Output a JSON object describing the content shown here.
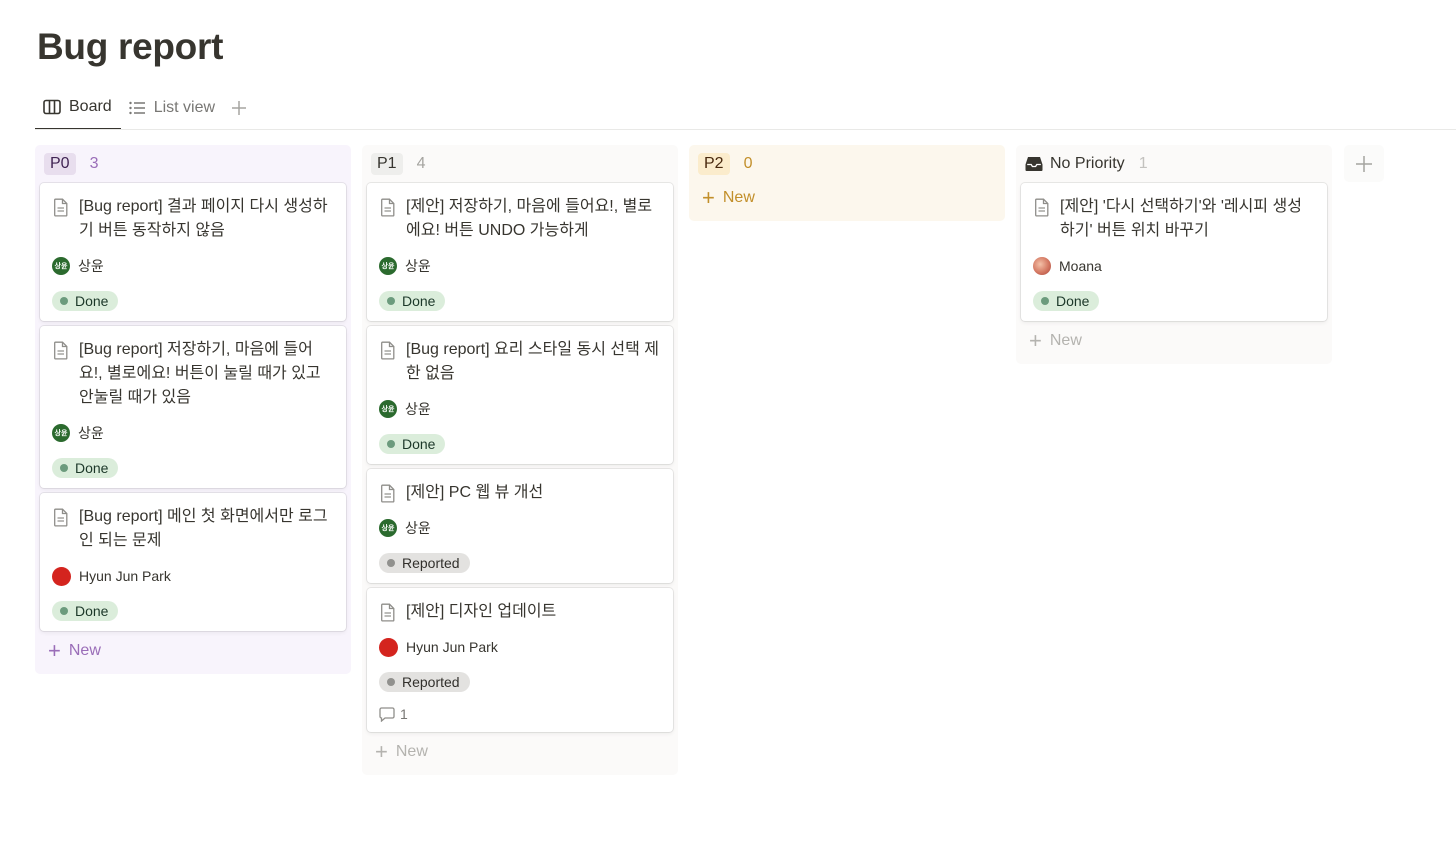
{
  "page": {
    "title": "Bug report"
  },
  "tabs": [
    {
      "label": "Board",
      "icon": "board-icon",
      "active": true
    },
    {
      "label": "List view",
      "icon": "list-icon",
      "active": false
    }
  ],
  "new_label": "New",
  "comment_icon": "comment-icon",
  "columns": [
    {
      "name": "P0",
      "count": "3",
      "colors": {
        "bg": "#f8f4fc",
        "pill_bg": "#e8deee",
        "pill_text": "#412454",
        "count": "#9a6db8",
        "new": "#9a6db8"
      },
      "cards": [
        {
          "title": "[Bug report] 결과 페이지 다시 생성하기 버튼 동작하지 않음",
          "assignee": "상윤",
          "status": "Done"
        },
        {
          "title": "[Bug report] 저장하기, 마음에 들어요!, 별로에요! 버튼이 눌릴 때가 있고 안눌릴 때가 있음",
          "assignee": "상윤",
          "status": "Done"
        },
        {
          "title": "[Bug report] 메인 첫 화면에서만 로그인 되는 문제",
          "assignee": "Hyun Jun Park",
          "status": "Done"
        }
      ]
    },
    {
      "name": "P1",
      "count": "4",
      "colors": {
        "bg": "#fbfaf9",
        "pill_bg": "#eeeeec",
        "pill_text": "#37352f",
        "count": "#a5a4a0",
        "new": "#b4b3af"
      },
      "cards": [
        {
          "title": "[제안] 저장하기, 마음에 들어요!, 별로에요! 버튼 UNDO 가능하게",
          "assignee": "상윤",
          "status": "Done"
        },
        {
          "title": "[Bug report] 요리 스타일 동시 선택 제한 없음",
          "assignee": "상윤",
          "status": "Done"
        },
        {
          "title": "[제안] PC 웹 뷰 개선",
          "assignee": "상윤",
          "status": "Reported"
        },
        {
          "title": "[제안] 디자인 업데이트",
          "assignee": "Hyun Jun Park",
          "status": "Reported",
          "comments": "1"
        }
      ]
    },
    {
      "name": "P2",
      "count": "0",
      "colors": {
        "bg": "#fcf7ed",
        "pill_bg": "#fbeccc",
        "pill_text": "#49290e",
        "count": "#c28f2a",
        "new": "#c28f2a"
      },
      "cards": []
    },
    {
      "name": "No Priority",
      "count": "1",
      "icon": "inbox-icon",
      "colors": {
        "bg": "#fbfaf9",
        "pill_bg": "transparent",
        "pill_text": "#37352f",
        "count": "#c3c2bf",
        "new": "#b4b3af"
      },
      "cards": [
        {
          "title": "[제안] '다시 선택하기'와 '레시피 생성하기' 버튼 위치 바꾸기",
          "assignee": "Moana",
          "status": "Done"
        }
      ]
    }
  ]
}
